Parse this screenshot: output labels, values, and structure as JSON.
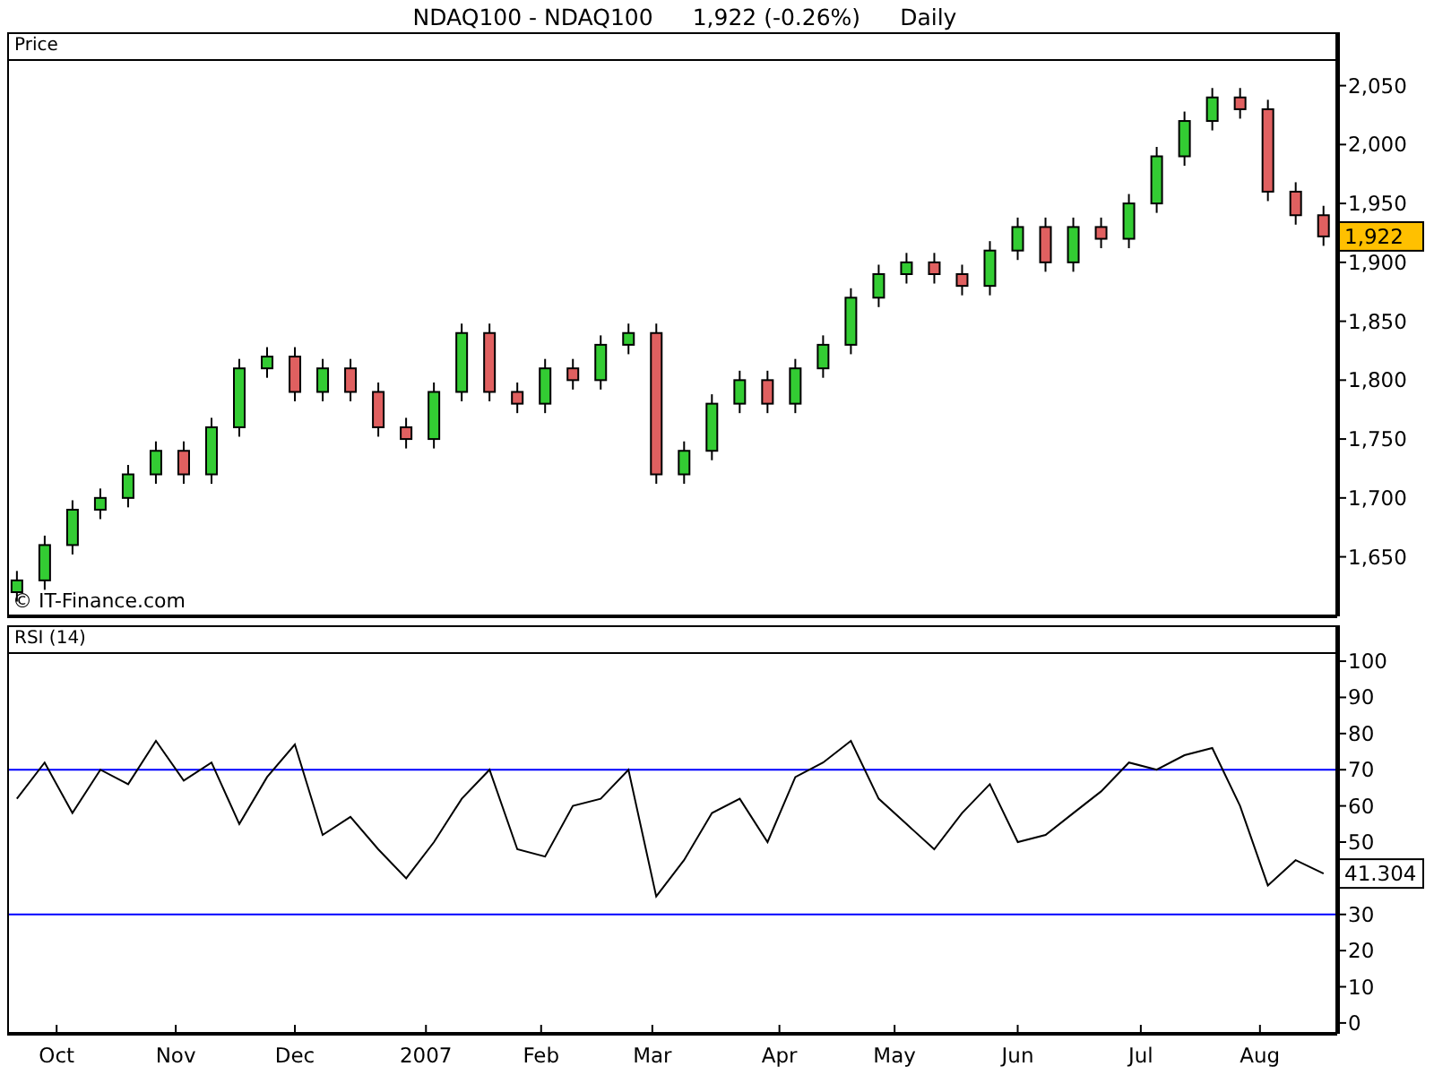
{
  "title": {
    "symbol": "NDAQ100 - NDAQ100",
    "quote": "1,922 (-0.26%)",
    "period": "Daily"
  },
  "price_panel": {
    "credit": "© IT-Finance.com",
    "last_label": "1,922",
    "chart_data": {
      "type": "candlestick",
      "title": "Price",
      "xlim": [
        "2006-09-20",
        "2007-08-20"
      ],
      "ylim": [
        1601,
        2071
      ],
      "x": [
        "2006-09-22",
        "2006-09-29",
        "2006-10-06",
        "2006-10-13",
        "2006-10-20",
        "2006-10-27",
        "2006-11-03",
        "2006-11-10",
        "2006-11-17",
        "2006-11-24",
        "2006-12-01",
        "2006-12-08",
        "2006-12-15",
        "2006-12-22",
        "2006-12-29",
        "2007-01-05",
        "2007-01-12",
        "2007-01-19",
        "2007-01-26",
        "2007-02-02",
        "2007-02-09",
        "2007-02-16",
        "2007-02-23",
        "2007-03-02",
        "2007-03-09",
        "2007-03-16",
        "2007-03-23",
        "2007-03-30",
        "2007-04-06",
        "2007-04-13",
        "2007-04-20",
        "2007-04-27",
        "2007-05-04",
        "2007-05-11",
        "2007-05-18",
        "2007-05-25",
        "2007-06-01",
        "2007-06-08",
        "2007-06-15",
        "2007-06-22",
        "2007-06-29",
        "2007-07-06",
        "2007-07-13",
        "2007-07-20",
        "2007-07-27",
        "2007-08-03",
        "2007-08-10",
        "2007-08-17"
      ],
      "ohlc": [
        [
          1620,
          1638,
          1612,
          1630
        ],
        [
          1630,
          1668,
          1622,
          1660
        ],
        [
          1660,
          1698,
          1652,
          1690
        ],
        [
          1690,
          1708,
          1682,
          1700
        ],
        [
          1700,
          1728,
          1692,
          1720
        ],
        [
          1720,
          1748,
          1712,
          1740
        ],
        [
          1740,
          1748,
          1712,
          1720
        ],
        [
          1720,
          1768,
          1712,
          1760
        ],
        [
          1760,
          1818,
          1752,
          1810
        ],
        [
          1810,
          1828,
          1802,
          1820
        ],
        [
          1820,
          1828,
          1782,
          1790
        ],
        [
          1790,
          1818,
          1782,
          1810
        ],
        [
          1810,
          1818,
          1782,
          1790
        ],
        [
          1790,
          1798,
          1752,
          1760
        ],
        [
          1760,
          1768,
          1742,
          1750
        ],
        [
          1750,
          1798,
          1742,
          1790
        ],
        [
          1790,
          1848,
          1782,
          1840
        ],
        [
          1840,
          1848,
          1782,
          1790
        ],
        [
          1790,
          1798,
          1772,
          1780
        ],
        [
          1780,
          1818,
          1772,
          1810
        ],
        [
          1810,
          1818,
          1792,
          1800
        ],
        [
          1800,
          1838,
          1792,
          1830
        ],
        [
          1830,
          1848,
          1822,
          1840
        ],
        [
          1840,
          1848,
          1712,
          1720
        ],
        [
          1720,
          1748,
          1712,
          1740
        ],
        [
          1740,
          1788,
          1732,
          1780
        ],
        [
          1780,
          1808,
          1772,
          1800
        ],
        [
          1800,
          1808,
          1772,
          1780
        ],
        [
          1780,
          1818,
          1772,
          1810
        ],
        [
          1810,
          1838,
          1802,
          1830
        ],
        [
          1830,
          1878,
          1822,
          1870
        ],
        [
          1870,
          1898,
          1862,
          1890
        ],
        [
          1890,
          1908,
          1882,
          1900
        ],
        [
          1900,
          1908,
          1882,
          1890
        ],
        [
          1890,
          1898,
          1872,
          1880
        ],
        [
          1880,
          1918,
          1872,
          1910
        ],
        [
          1910,
          1938,
          1902,
          1930
        ],
        [
          1930,
          1938,
          1892,
          1900
        ],
        [
          1900,
          1938,
          1892,
          1930
        ],
        [
          1930,
          1938,
          1912,
          1920
        ],
        [
          1920,
          1958,
          1912,
          1950
        ],
        [
          1950,
          1998,
          1942,
          1990
        ],
        [
          1990,
          2028,
          1982,
          2020
        ],
        [
          2020,
          2048,
          2012,
          2040
        ],
        [
          2040,
          2048,
          2022,
          2030
        ],
        [
          2030,
          2038,
          1952,
          1960
        ],
        [
          1960,
          1968,
          1932,
          1940
        ],
        [
          1940,
          1948,
          1914,
          1922
        ]
      ],
      "yticks": [
        {
          "value": 1650,
          "label": "1,650"
        },
        {
          "value": 1700,
          "label": "1,700"
        },
        {
          "value": 1750,
          "label": "1,750"
        },
        {
          "value": 1800,
          "label": "1,800"
        },
        {
          "value": 1850,
          "label": "1,850"
        },
        {
          "value": 1900,
          "label": "1,900"
        },
        {
          "value": 1950,
          "label": "1,950"
        },
        {
          "value": 2000,
          "label": "2,000"
        },
        {
          "value": 2050,
          "label": "2,050"
        }
      ]
    }
  },
  "rsi_panel": {
    "last_label": "41.304",
    "chart_data": {
      "type": "line",
      "title": "RSI (14)",
      "xlim": [
        "2006-09-20",
        "2007-08-20"
      ],
      "ylim": [
        -2.5,
        102
      ],
      "x": [
        "2006-09-22",
        "2006-09-29",
        "2006-10-06",
        "2006-10-13",
        "2006-10-20",
        "2006-10-27",
        "2006-11-03",
        "2006-11-10",
        "2006-11-17",
        "2006-11-24",
        "2006-12-01",
        "2006-12-08",
        "2006-12-15",
        "2006-12-22",
        "2006-12-29",
        "2007-01-05",
        "2007-01-12",
        "2007-01-19",
        "2007-01-26",
        "2007-02-02",
        "2007-02-09",
        "2007-02-16",
        "2007-02-23",
        "2007-03-02",
        "2007-03-09",
        "2007-03-16",
        "2007-03-23",
        "2007-03-30",
        "2007-04-06",
        "2007-04-13",
        "2007-04-20",
        "2007-04-27",
        "2007-05-04",
        "2007-05-11",
        "2007-05-18",
        "2007-05-25",
        "2007-06-01",
        "2007-06-08",
        "2007-06-15",
        "2007-06-22",
        "2007-06-29",
        "2007-07-06",
        "2007-07-13",
        "2007-07-20",
        "2007-07-27",
        "2007-08-03",
        "2007-08-10",
        "2007-08-17"
      ],
      "series": [
        {
          "color": "#000000",
          "values": [
            62,
            72,
            58,
            70,
            66,
            78,
            67,
            72,
            55,
            68,
            77,
            52,
            57,
            48,
            40,
            50,
            62,
            70,
            48,
            46,
            60,
            62,
            70,
            35,
            45,
            58,
            62,
            50,
            68,
            72,
            78,
            62,
            55,
            48,
            58,
            66,
            50,
            52,
            58,
            64,
            72,
            70,
            74,
            76,
            60,
            38,
            45,
            41.3
          ]
        }
      ],
      "xticks": [
        {
          "value": "2006-10-02",
          "label": "Oct"
        },
        {
          "value": "2006-11-01",
          "label": "Nov"
        },
        {
          "value": "2006-12-01",
          "label": "Dec"
        },
        {
          "value": "2007-01-03",
          "label": "2007"
        },
        {
          "value": "2007-02-01",
          "label": "Feb"
        },
        {
          "value": "2007-03-01",
          "label": "Mar"
        },
        {
          "value": "2007-04-02",
          "label": "Apr"
        },
        {
          "value": "2007-05-01",
          "label": "May"
        },
        {
          "value": "2007-06-01",
          "label": "Jun"
        },
        {
          "value": "2007-07-02",
          "label": "Jul"
        },
        {
          "value": "2007-08-01",
          "label": "Aug"
        }
      ],
      "yticks": [
        {
          "value": 0,
          "label": "0"
        },
        {
          "value": 10,
          "label": "10"
        },
        {
          "value": 20,
          "label": "20"
        },
        {
          "value": 30,
          "label": "30"
        },
        {
          "value": 50,
          "label": "50"
        },
        {
          "value": 60,
          "label": "60"
        },
        {
          "value": 70,
          "label": "70"
        },
        {
          "value": 80,
          "label": "80"
        },
        {
          "value": 90,
          "label": "90"
        },
        {
          "value": 100,
          "label": "100"
        }
      ],
      "ref_lines": [
        {
          "axis": "y",
          "value": 70,
          "color": "#0000ff"
        },
        {
          "axis": "y",
          "value": 30,
          "color": "#0000ff"
        }
      ]
    }
  }
}
